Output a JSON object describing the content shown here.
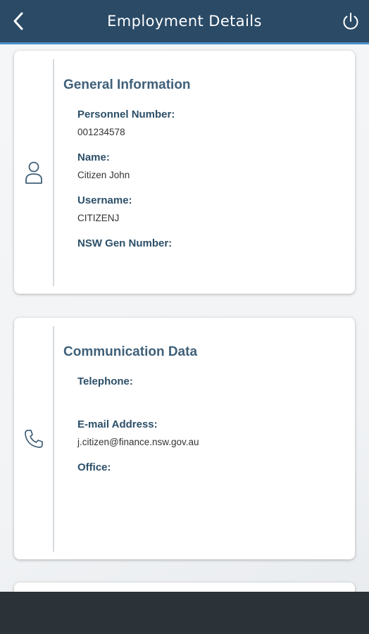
{
  "header": {
    "title": "Employment Details",
    "back_icon": "chevron-left-icon",
    "power_icon": "power-icon"
  },
  "cards": [
    {
      "icon": "person-icon",
      "title": "General Information",
      "fields": [
        {
          "label": "Personnel Number:",
          "value": "001234578"
        },
        {
          "label": "Name:",
          "value": "Citizen John"
        },
        {
          "label": "Username:",
          "value": "CITIZENJ"
        },
        {
          "label": "NSW Gen Number:",
          "value": ""
        }
      ]
    },
    {
      "icon": "phone-icon",
      "title": "Communication Data",
      "fields": [
        {
          "label": "Telephone:",
          "value": ""
        },
        {
          "label": "E-mail Address:",
          "value": "j.citizen@finance.nsw.gov.au"
        },
        {
          "label": "Office:",
          "value": ""
        }
      ]
    }
  ],
  "colors": {
    "header_bg": "#2a4a66",
    "header_accent": "#4b8ec9",
    "title_color": "#3f6079",
    "label_color": "#2c4f68",
    "bottom_bar": "#2b3238"
  }
}
